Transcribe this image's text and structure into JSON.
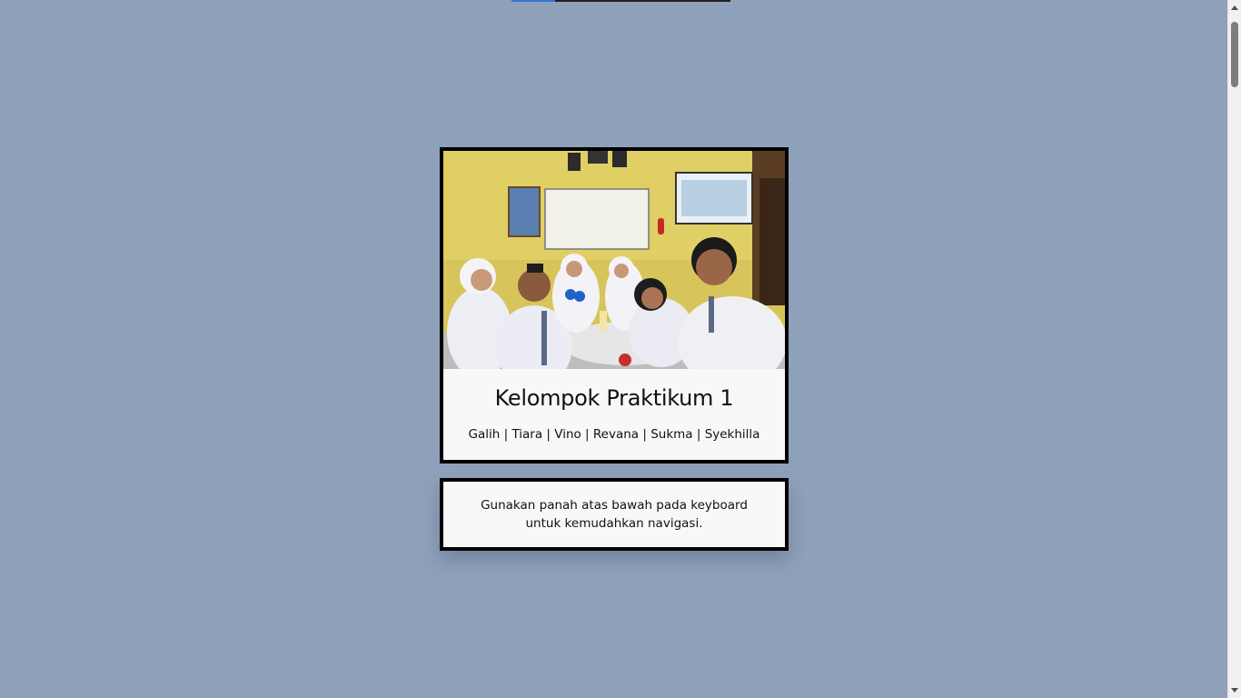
{
  "progress": {
    "fraction": 0.2,
    "fill_color": "#3b6fd8",
    "track_color": "#1f1f1f"
  },
  "card": {
    "photo_icon": "group-photo-image",
    "title": "Kelompok Praktikum 1",
    "members": "Galih | Tiara | Vino | Revana | Sukma | Syekhilla"
  },
  "hint": {
    "text": "Gunakan panah atas bawah pada keyboard untuk kemudahkan navigasi."
  },
  "colors": {
    "page_background": "#8fa0ba",
    "card_background": "#f8f8f8",
    "border": "#000000"
  }
}
